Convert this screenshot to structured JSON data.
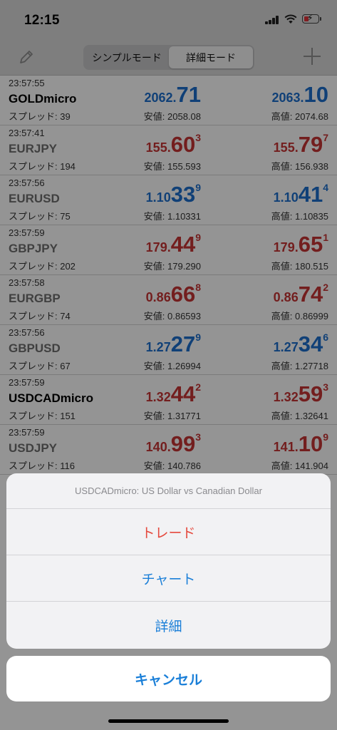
{
  "status": {
    "time": "12:15"
  },
  "nav": {
    "segments": [
      {
        "label": "シンプルモード",
        "active": false
      },
      {
        "label": "詳細モード",
        "active": true
      }
    ]
  },
  "quotes": [
    {
      "time": "23:57:55",
      "symbol": "GOLDmicro",
      "selected": true,
      "spread": "スプレッド: 39",
      "bid": {
        "small": "2062.",
        "big": "71",
        "sup": "",
        "dir": "up"
      },
      "ask": {
        "small": "2063.",
        "big": "10",
        "sup": "",
        "dir": "up"
      },
      "low": "安値: 2058.08",
      "high": "高値: 2074.68"
    },
    {
      "time": "23:57:41",
      "symbol": "EURJPY",
      "selected": false,
      "spread": "スプレッド: 194",
      "bid": {
        "small": "155.",
        "big": "60",
        "sup": "3",
        "dir": "down"
      },
      "ask": {
        "small": "155.",
        "big": "79",
        "sup": "7",
        "dir": "down"
      },
      "low": "安値: 155.593",
      "high": "高値: 156.938"
    },
    {
      "time": "23:57:56",
      "symbol": "EURUSD",
      "selected": false,
      "spread": "スプレッド: 75",
      "bid": {
        "small": "1.10",
        "big": "33",
        "sup": "9",
        "dir": "up"
      },
      "ask": {
        "small": "1.10",
        "big": "41",
        "sup": "4",
        "dir": "up"
      },
      "low": "安値: 1.10331",
      "high": "高値: 1.10835"
    },
    {
      "time": "23:57:59",
      "symbol": "GBPJPY",
      "selected": false,
      "spread": "スプレッド: 202",
      "bid": {
        "small": "179.",
        "big": "44",
        "sup": "9",
        "dir": "down"
      },
      "ask": {
        "small": "179.",
        "big": "65",
        "sup": "1",
        "dir": "down"
      },
      "low": "安値: 179.290",
      "high": "高値: 180.515"
    },
    {
      "time": "23:57:58",
      "symbol": "EURGBP",
      "selected": false,
      "spread": "スプレッド: 74",
      "bid": {
        "small": "0.86",
        "big": "66",
        "sup": "8",
        "dir": "down"
      },
      "ask": {
        "small": "0.86",
        "big": "74",
        "sup": "2",
        "dir": "down"
      },
      "low": "安値: 0.86593",
      "high": "高値: 0.86999"
    },
    {
      "time": "23:57:56",
      "symbol": "GBPUSD",
      "selected": false,
      "spread": "スプレッド: 67",
      "bid": {
        "small": "1.27",
        "big": "27",
        "sup": "9",
        "dir": "up"
      },
      "ask": {
        "small": "1.27",
        "big": "34",
        "sup": "6",
        "dir": "up"
      },
      "low": "安値: 1.26994",
      "high": "高値: 1.27718"
    },
    {
      "time": "23:57:59",
      "symbol": "USDCADmicro",
      "selected": true,
      "spread": "スプレッド: 151",
      "bid": {
        "small": "1.32",
        "big": "44",
        "sup": "2",
        "dir": "down"
      },
      "ask": {
        "small": "1.32",
        "big": "59",
        "sup": "3",
        "dir": "down"
      },
      "low": "安値: 1.31771",
      "high": "高値: 1.32641"
    },
    {
      "time": "23:57:59",
      "symbol": "USDJPY",
      "selected": false,
      "spread": "スプレッド: 116",
      "bid": {
        "small": "140.",
        "big": "99",
        "sup": "3",
        "dir": "down"
      },
      "ask": {
        "small": "141.",
        "big": "10",
        "sup": "9",
        "dir": "down"
      },
      "low": "安値: 140.786",
      "high": "高値: 141.904"
    }
  ],
  "sheet": {
    "title": "USDCADmicro: US Dollar vs Canadian Dollar",
    "actions": [
      {
        "label": "トレード",
        "style": "destructive"
      },
      {
        "label": "チャート",
        "style": "default"
      },
      {
        "label": "詳細",
        "style": "default"
      }
    ],
    "cancel_label": "キャンセル"
  },
  "colors": {
    "up": "#1d6fce",
    "down": "#c63535",
    "tint": "#1a7fd8",
    "destructive": "#e5483c"
  }
}
